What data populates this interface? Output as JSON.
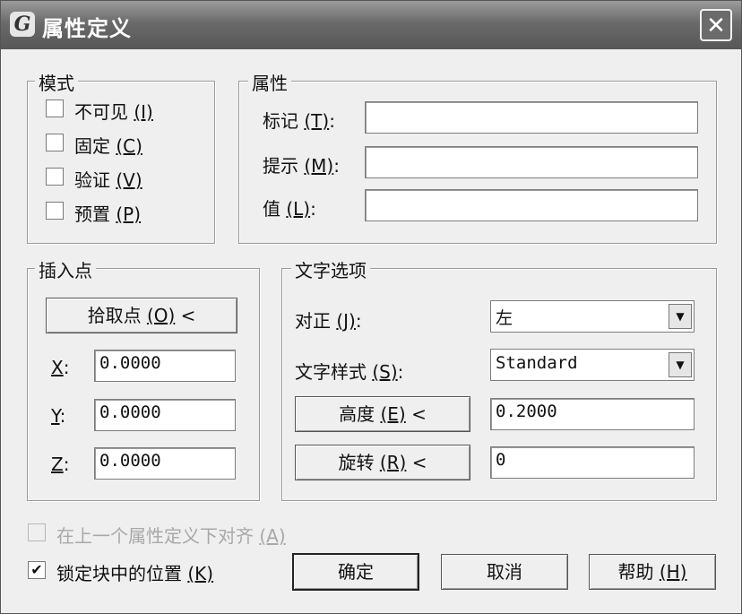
{
  "window": {
    "title": "属性定义",
    "close_glyph": "✕",
    "icon_glyph": "G"
  },
  "mode": {
    "title": "模式",
    "items": [
      {
        "label": "不可见",
        "hotkey": "(I)",
        "checked": false
      },
      {
        "label": "固定",
        "hotkey": "(C)",
        "checked": false
      },
      {
        "label": "验证",
        "hotkey": "(V)",
        "checked": false
      },
      {
        "label": "预置",
        "hotkey": "(P)",
        "checked": false
      }
    ]
  },
  "attribute": {
    "title": "属性",
    "tag_label": "标记",
    "tag_hotkey": "(T)",
    "tag_colon": ":",
    "tag_value": "",
    "prompt_label": "提示",
    "prompt_hotkey": "(M)",
    "prompt_colon": ":",
    "prompt_value": "",
    "value_label": "值",
    "value_hotkey": "(L)",
    "value_colon": ":",
    "value_value": ""
  },
  "insertion": {
    "title": "插入点",
    "pick_button": "拾取点",
    "pick_hotkey": "(O)",
    "pick_arrow": "<",
    "x_label": "X",
    "x_colon": ":",
    "x_value": "0.0000",
    "y_label": "Y",
    "y_colon": ":",
    "y_value": "0.0000",
    "z_label": "Z",
    "z_colon": ":",
    "z_value": "0.0000"
  },
  "text_options": {
    "title": "文字选项",
    "justify_label": "对正",
    "justify_hotkey": "(J)",
    "justify_colon": ":",
    "justify_value": "左",
    "style_label": "文字样式",
    "style_hotkey": "(S)",
    "style_colon": ":",
    "style_value": "Standard",
    "height_button": "高度",
    "height_hotkey": "(E)",
    "height_arrow": "<",
    "height_value": "0.2000",
    "rotation_button": "旋转",
    "rotation_hotkey": "(R)",
    "rotation_arrow": "<",
    "rotation_value": "0"
  },
  "bottom": {
    "align_label": "在上一个属性定义下对齐",
    "align_hotkey": "(A)",
    "align_checked": false,
    "align_enabled": false,
    "lock_label": "锁定块中的位置",
    "lock_hotkey": "(K)",
    "lock_checked": true,
    "check_glyph": "✔",
    "ok": "确定",
    "cancel": "取消",
    "help": "帮助",
    "help_hotkey": "(H)"
  },
  "dropdown_glyph": "▼"
}
